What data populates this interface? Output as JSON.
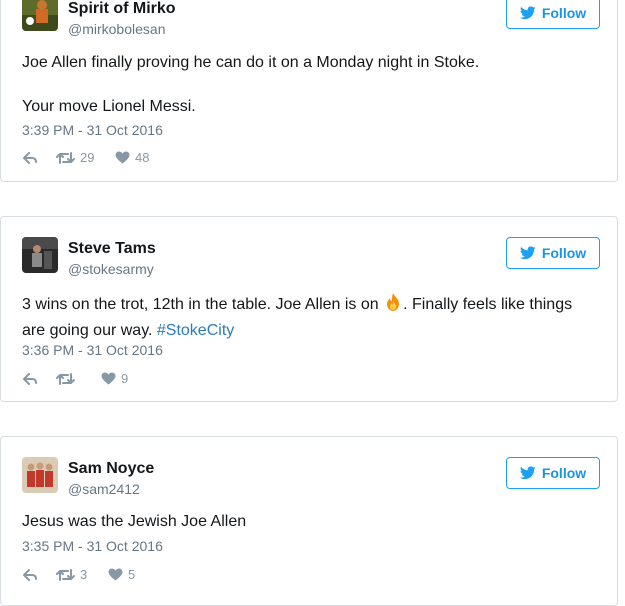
{
  "follow_label": "Follow",
  "colors": {
    "accent": "#1da1f2",
    "link": "#2b7bb9",
    "muted": "#8899a6"
  },
  "tweets": [
    {
      "name": "Spirit of Mirko",
      "handle": "@mirkobolesan",
      "paragraphs": [
        "Joe Allen finally proving he can do it on a Monday night in Stoke.",
        "Your move Lionel Messi."
      ],
      "time": "3:39 PM - 31 Oct 2016",
      "retweets": "29",
      "likes": "48"
    },
    {
      "name": "Steve Tams",
      "handle": "@stokesarmy",
      "text_before": "3 wins on the trot, 12th in the table. Joe Allen is on ",
      "emoji": "fire-emoji",
      "text_after": ". Finally feels like things are going our way. ",
      "hashtag": "#StokeCity",
      "time": "3:36 PM - 31 Oct 2016",
      "retweets": "",
      "likes": "9"
    },
    {
      "name": "Sam Noyce",
      "handle": "@sam2412",
      "paragraphs": [
        "Jesus was the Jewish Joe Allen"
      ],
      "time": "3:35 PM - 31 Oct 2016",
      "retweets": "3",
      "likes": "5"
    }
  ]
}
